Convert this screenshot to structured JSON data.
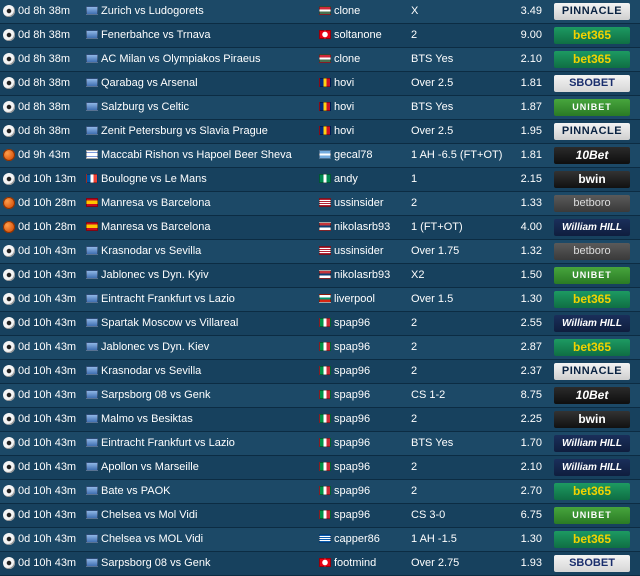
{
  "colors": {
    "background": "#123a57",
    "row_odd": "#1c4967",
    "row_even": "#17415e",
    "text": "#ffffff"
  },
  "tips": [
    {
      "sport": "soccer",
      "time": "0d 8h 38m",
      "league_flag": "world",
      "match": "Zurich vs Ludogorets",
      "user_flag": "hungary",
      "user": "clone",
      "pick": "X",
      "odds": "3.49",
      "bookmaker": "PINNACLE",
      "bm_style": "pinnacle"
    },
    {
      "sport": "soccer",
      "time": "0d 8h 38m",
      "league_flag": "world",
      "match": "Fenerbahce vs Trnava",
      "user_flag": "tunisia",
      "user": "soltanone",
      "pick": "2",
      "odds": "9.00",
      "bookmaker": "bet365",
      "bm_style": "bet365"
    },
    {
      "sport": "soccer",
      "time": "0d 8h 38m",
      "league_flag": "world",
      "match": "AC Milan vs Olympiakos Piraeus",
      "user_flag": "hungary",
      "user": "clone",
      "pick": "BTS Yes",
      "odds": "2.10",
      "bookmaker": "bet365",
      "bm_style": "bet365"
    },
    {
      "sport": "soccer",
      "time": "0d 8h 38m",
      "league_flag": "world",
      "match": "Qarabag vs Arsenal",
      "user_flag": "romania",
      "user": "hovi",
      "pick": "Over 2.5",
      "odds": "1.81",
      "bookmaker": "SBOBET",
      "bm_style": "sbobet"
    },
    {
      "sport": "soccer",
      "time": "0d 8h 38m",
      "league_flag": "world",
      "match": "Salzburg vs Celtic",
      "user_flag": "romania",
      "user": "hovi",
      "pick": "BTS Yes",
      "odds": "1.87",
      "bookmaker": "UNIBET",
      "bm_style": "unibet"
    },
    {
      "sport": "soccer",
      "time": "0d 8h 38m",
      "league_flag": "world",
      "match": "Zenit Petersburg vs Slavia Prague",
      "user_flag": "romania",
      "user": "hovi",
      "pick": "Over 2.5",
      "odds": "1.95",
      "bookmaker": "PINNACLE",
      "bm_style": "pinnacle"
    },
    {
      "sport": "basketball",
      "time": "0d 9h 43m",
      "league_flag": "israel",
      "match": "Maccabi Rishon vs Hapoel Beer Sheva",
      "user_flag": "argentina",
      "user": "gecal78",
      "pick": "1 AH -6.5 (FT+OT)",
      "odds": "1.81",
      "bookmaker": "10Bet",
      "bm_style": "tenbet"
    },
    {
      "sport": "soccer",
      "time": "0d 10h 13m",
      "league_flag": "france",
      "match": "Boulogne vs Le Mans",
      "user_flag": "nigeria",
      "user": "andy",
      "pick": "1",
      "odds": "2.15",
      "bookmaker": "bwin",
      "bm_style": "bwin"
    },
    {
      "sport": "basketball",
      "time": "0d 10h 28m",
      "league_flag": "spain",
      "match": "Manresa vs Barcelona",
      "user_flag": "usa",
      "user": "ussinsider",
      "pick": "2",
      "odds": "1.33",
      "bookmaker": "betboro",
      "bm_style": "betboro"
    },
    {
      "sport": "basketball",
      "time": "0d 10h 28m",
      "league_flag": "spain",
      "match": "Manresa vs Barcelona",
      "user_flag": "serbia",
      "user": "nikolasrb93",
      "pick": "1 (FT+OT)",
      "odds": "4.00",
      "bookmaker": "William HILL",
      "bm_style": "williamhill"
    },
    {
      "sport": "soccer",
      "time": "0d 10h 43m",
      "league_flag": "world",
      "match": "Krasnodar vs Sevilla",
      "user_flag": "usa",
      "user": "ussinsider",
      "pick": "Over 1.75",
      "odds": "1.32",
      "bookmaker": "betboro",
      "bm_style": "betboro"
    },
    {
      "sport": "soccer",
      "time": "0d 10h 43m",
      "league_flag": "world",
      "match": "Jablonec vs Dyn. Kyiv",
      "user_flag": "serbia",
      "user": "nikolasrb93",
      "pick": "X2",
      "odds": "1.50",
      "bookmaker": "UNIBET",
      "bm_style": "unibet"
    },
    {
      "sport": "soccer",
      "time": "0d 10h 43m",
      "league_flag": "world",
      "match": "Eintracht Frankfurt vs Lazio",
      "user_flag": "bulgaria",
      "user": "liverpool",
      "pick": "Over 1.5",
      "odds": "1.30",
      "bookmaker": "bet365",
      "bm_style": "bet365"
    },
    {
      "sport": "soccer",
      "time": "0d 10h 43m",
      "league_flag": "world",
      "match": "Spartak Moscow vs Villareal",
      "user_flag": "italy",
      "user": "spap96",
      "pick": "2",
      "odds": "2.55",
      "bookmaker": "William HILL",
      "bm_style": "williamhill"
    },
    {
      "sport": "soccer",
      "time": "0d 10h 43m",
      "league_flag": "world",
      "match": "Jablonec vs Dyn. Kiev",
      "user_flag": "italy",
      "user": "spap96",
      "pick": "2",
      "odds": "2.87",
      "bookmaker": "bet365",
      "bm_style": "bet365"
    },
    {
      "sport": "soccer",
      "time": "0d 10h 43m",
      "league_flag": "world",
      "match": "Krasnodar vs Sevilla",
      "user_flag": "italy",
      "user": "spap96",
      "pick": "2",
      "odds": "2.37",
      "bookmaker": "PINNACLE",
      "bm_style": "pinnacle"
    },
    {
      "sport": "soccer",
      "time": "0d 10h 43m",
      "league_flag": "world",
      "match": "Sarpsborg 08 vs Genk",
      "user_flag": "italy",
      "user": "spap96",
      "pick": "CS 1-2",
      "odds": "8.75",
      "bookmaker": "10Bet",
      "bm_style": "tenbet"
    },
    {
      "sport": "soccer",
      "time": "0d 10h 43m",
      "league_flag": "world",
      "match": "Malmo vs Besiktas",
      "user_flag": "italy",
      "user": "spap96",
      "pick": "2",
      "odds": "2.25",
      "bookmaker": "bwin",
      "bm_style": "bwin"
    },
    {
      "sport": "soccer",
      "time": "0d 10h 43m",
      "league_flag": "world",
      "match": "Eintracht Frankfurt vs Lazio",
      "user_flag": "italy",
      "user": "spap96",
      "pick": "BTS Yes",
      "odds": "1.70",
      "bookmaker": "William HILL",
      "bm_style": "williamhill"
    },
    {
      "sport": "soccer",
      "time": "0d 10h 43m",
      "league_flag": "world",
      "match": "Apollon vs Marseille",
      "user_flag": "italy",
      "user": "spap96",
      "pick": "2",
      "odds": "2.10",
      "bookmaker": "William HILL",
      "bm_style": "williamhill"
    },
    {
      "sport": "soccer",
      "time": "0d 10h 43m",
      "league_flag": "world",
      "match": "Bate vs PAOK",
      "user_flag": "italy",
      "user": "spap96",
      "pick": "2",
      "odds": "2.70",
      "bookmaker": "bet365",
      "bm_style": "bet365"
    },
    {
      "sport": "soccer",
      "time": "0d 10h 43m",
      "league_flag": "world",
      "match": "Chelsea vs Mol Vidi",
      "user_flag": "italy",
      "user": "spap96",
      "pick": "CS 3-0",
      "odds": "6.75",
      "bookmaker": "UNIBET",
      "bm_style": "unibet"
    },
    {
      "sport": "soccer",
      "time": "0d 10h 43m",
      "league_flag": "world",
      "match": "Chelsea vs MOL Vidi",
      "user_flag": "greece",
      "user": "capper86",
      "pick": "1 AH -1.5",
      "odds": "1.30",
      "bookmaker": "bet365",
      "bm_style": "bet365"
    },
    {
      "sport": "soccer",
      "time": "0d 10h 43m",
      "league_flag": "world",
      "match": "Sarpsborg 08 vs Genk",
      "user_flag": "tunisia",
      "user": "footmind",
      "pick": "Over 2.75",
      "odds": "1.93",
      "bookmaker": "SBOBET",
      "bm_style": "sbobet"
    }
  ]
}
